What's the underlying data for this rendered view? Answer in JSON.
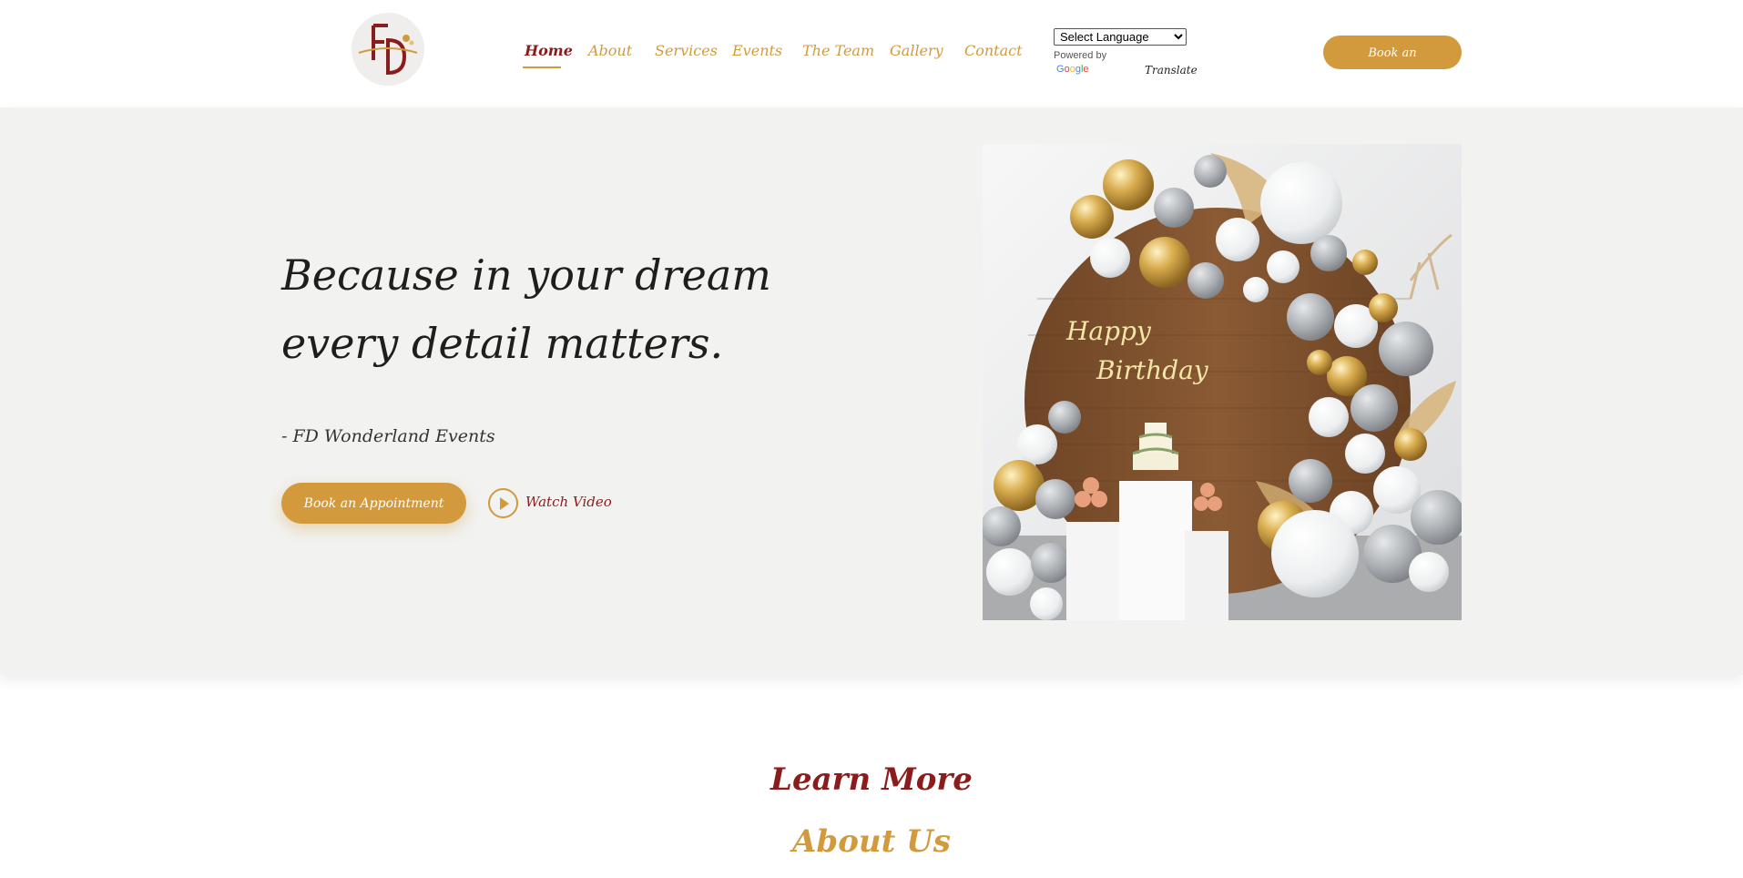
{
  "header": {
    "logo": {
      "monogram": "FD",
      "icon": "fd-wonderland-logo"
    },
    "nav": [
      {
        "label": "Home",
        "active": true
      },
      {
        "label": "About"
      },
      {
        "label": "Services"
      },
      {
        "label": "Events"
      },
      {
        "label": "The Team"
      },
      {
        "label": "Gallery"
      },
      {
        "label": "Contact"
      }
    ],
    "language": {
      "selected": "Select Language",
      "powered_by": "Powered by",
      "google": "Google",
      "translate": "Translate"
    },
    "cta": "Book an Appointment"
  },
  "hero": {
    "title": "Because in your dream every detail matters.",
    "attribution": "- FD Wonderland Events",
    "cta": "Book an Appointment",
    "video_label": "Watch Video",
    "video_icon": "play-icon",
    "image": {
      "icon": "birthday-balloon-arch-image",
      "sign_line1": "Happy",
      "sign_line2": "Birthday"
    }
  },
  "sections": {
    "learn_more": "Learn More",
    "about_us": "About Us"
  },
  "colors": {
    "gold": "#d29a3d",
    "maroon": "#8a1c1c",
    "hero_bg": "#f2f2f0",
    "text_dark": "#1e1e1e"
  }
}
